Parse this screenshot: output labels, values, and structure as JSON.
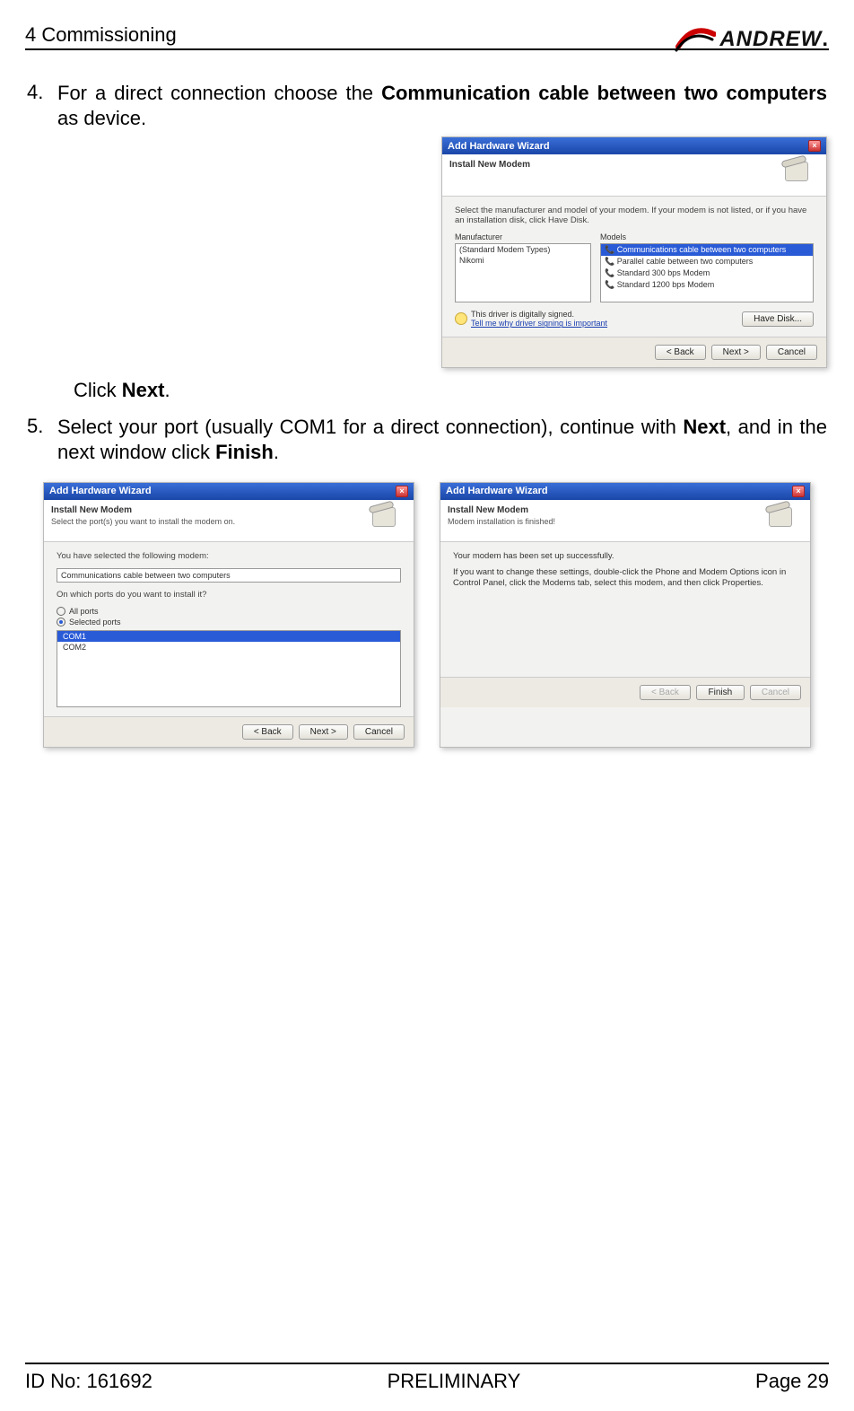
{
  "header": {
    "section": "4 Commissioning",
    "brand": "ANDREW",
    "brand_dot": "."
  },
  "steps": {
    "s4": {
      "num": "4.",
      "text_pre": "For a direct connection choose the ",
      "bold": "Communication cable between two computers",
      "text_post": " as device.",
      "click_pre": "Click ",
      "click_bold": "Next",
      "click_post": "."
    },
    "s5": {
      "num": "5.",
      "t1": "Select your port (usually COM1 for a direct connection), continue with ",
      "b1": "Next",
      "t2": ", and in the next window click ",
      "b2": "Finish",
      "t3": "."
    }
  },
  "wiz1": {
    "title": "Add Hardware Wizard",
    "header_title": "Install New Modem",
    "instr": "Select the manufacturer and model of your modem. If your modem is not listed, or if you have an installation disk, click Have Disk.",
    "manu_label": "Manufacturer",
    "models_label": "Models",
    "manu_items": [
      "(Standard Modem Types)",
      "Nikomi"
    ],
    "model_items": [
      "Communications cable between two computers",
      "Parallel cable between two computers",
      "Standard 300 bps Modem",
      "Standard 1200 bps Modem"
    ],
    "signed": "This driver is digitally signed.",
    "tell": "Tell me why driver signing is important",
    "have_disk": "Have Disk...",
    "back": "< Back",
    "next": "Next >",
    "cancel": "Cancel"
  },
  "wiz2": {
    "title": "Add Hardware Wizard",
    "header_title": "Install New Modem",
    "header_sub": "Select the port(s) you want to install the modem on.",
    "sel_text": "You have selected the following modem:",
    "sel_val": "Communications cable between two computers",
    "q": "On which ports do you want to install it?",
    "r_all": "All ports",
    "r_sel": "Selected ports",
    "ports": [
      "COM1",
      "COM2"
    ],
    "back": "< Back",
    "next": "Next >",
    "cancel": "Cancel"
  },
  "wiz3": {
    "title": "Add Hardware Wizard",
    "header_title": "Install New Modem",
    "header_sub": "Modem installation is finished!",
    "l1": "Your modem has been set up successfully.",
    "l2": "If you want to change these settings, double-click the Phone and Modem Options icon in Control Panel, click the Modems tab, select this modem, and then click Properties.",
    "back": "< Back",
    "finish": "Finish",
    "cancel": "Cancel"
  },
  "footer": {
    "left": "ID No: 161692",
    "center": "PRELIMINARY",
    "right": "Page 29"
  }
}
